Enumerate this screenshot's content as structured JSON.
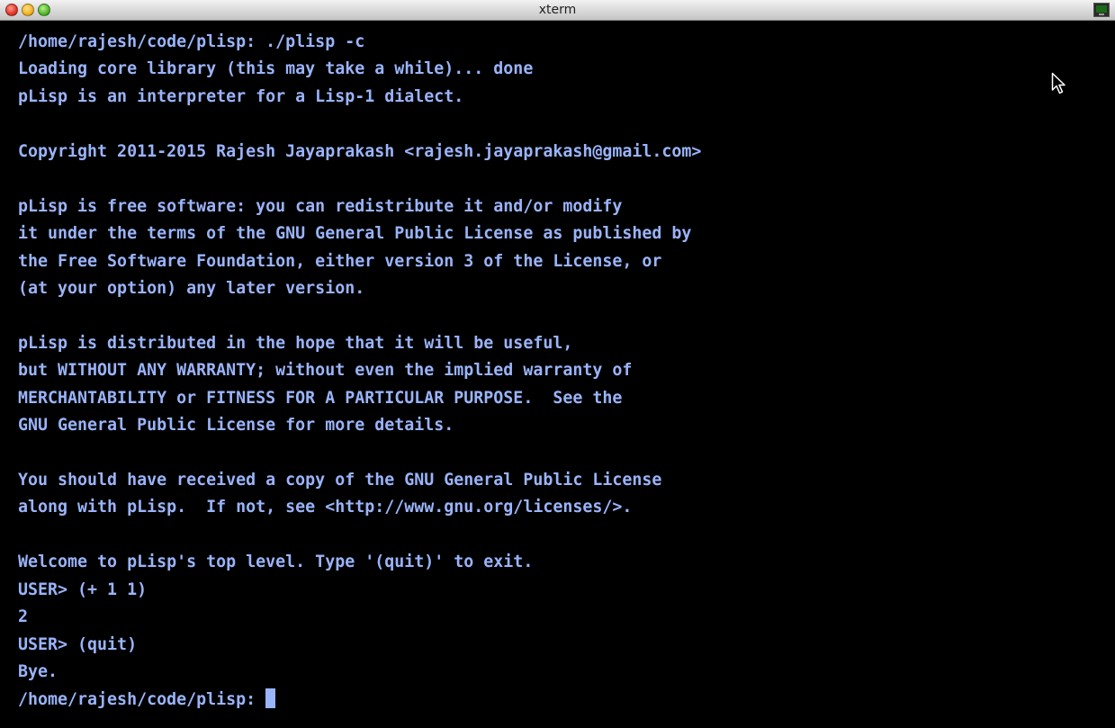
{
  "window": {
    "title": "xterm"
  },
  "colors": {
    "background": "#000000",
    "foreground": "#9ab4fa",
    "titlebar": "#d9d9d9"
  },
  "icons": {
    "window_buttons": [
      "close-icon",
      "minimize-icon",
      "maximize-icon"
    ],
    "app": "xterm-icon",
    "pointer": "mouse-pointer-icon"
  },
  "terminal": {
    "lines": [
      "/home/rajesh/code/plisp: ./plisp -c",
      "Loading core library (this may take a while)... done",
      "pLisp is an interpreter for a Lisp-1 dialect.",
      "",
      "Copyright 2011-2015 Rajesh Jayaprakash <rajesh.jayaprakash@gmail.com>",
      "",
      "pLisp is free software: you can redistribute it and/or modify",
      "it under the terms of the GNU General Public License as published by",
      "the Free Software Foundation, either version 3 of the License, or",
      "(at your option) any later version.",
      "",
      "pLisp is distributed in the hope that it will be useful,",
      "but WITHOUT ANY WARRANTY; without even the implied warranty of",
      "MERCHANTABILITY or FITNESS FOR A PARTICULAR PURPOSE.  See the",
      "GNU General Public License for more details.",
      "",
      "You should have received a copy of the GNU General Public License",
      "along with pLisp.  If not, see <http://www.gnu.org/licenses/>.",
      "",
      "Welcome to pLisp's top level. Type '(quit)' to exit.",
      "USER> (+ 1 1)",
      "2",
      "USER> (quit)",
      "Bye."
    ],
    "prompt": "/home/rajesh/code/plisp: "
  }
}
